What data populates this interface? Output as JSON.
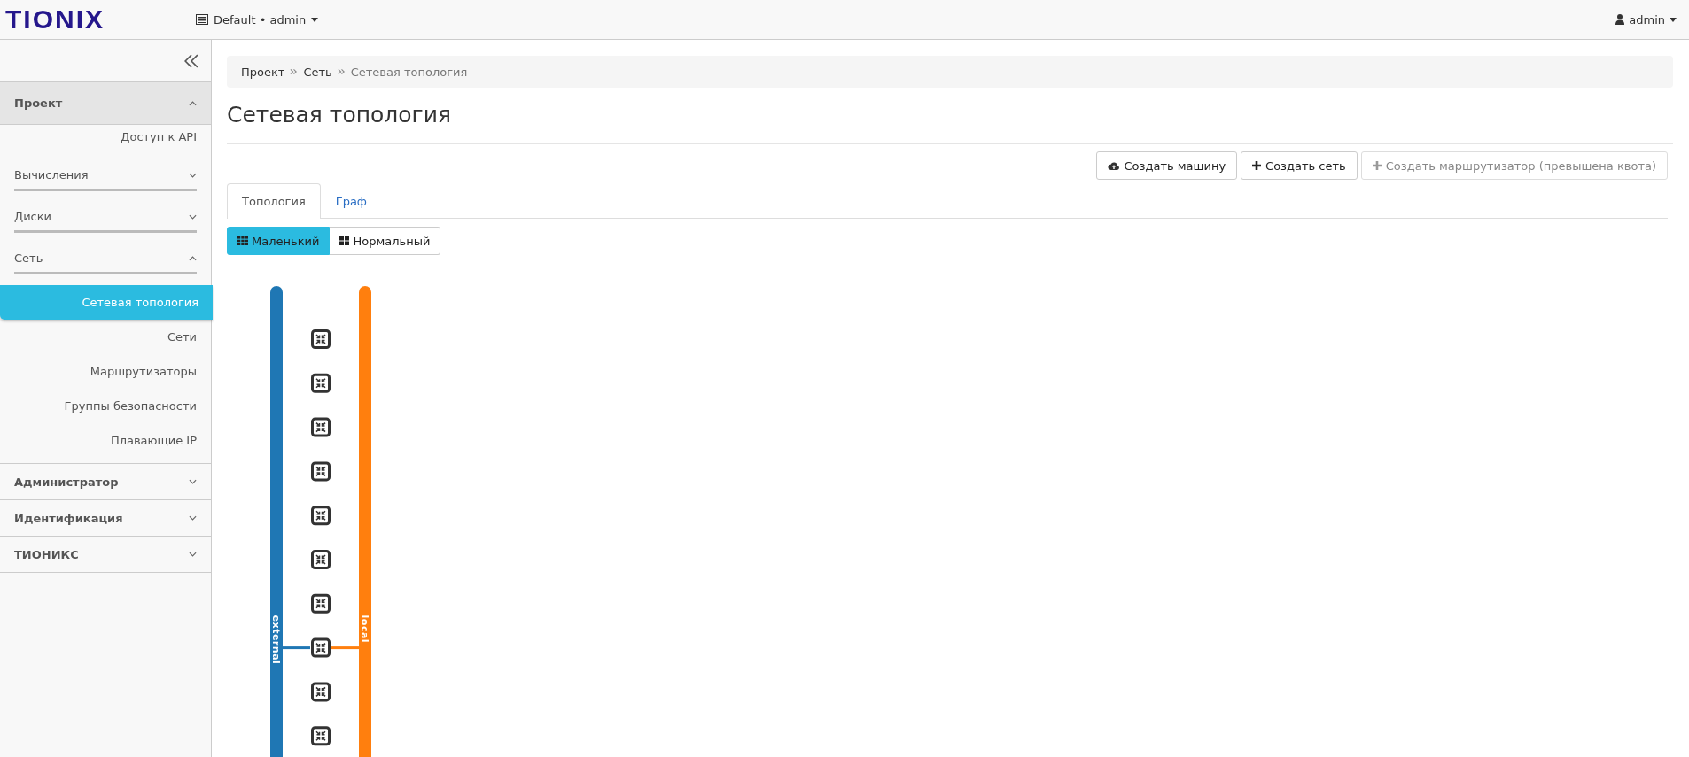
{
  "header": {
    "logo": "TIONIX",
    "project_menu": "Default • admin",
    "user_menu": "admin"
  },
  "sidebar": {
    "sections": [
      {
        "label": "Проект",
        "expanded": true,
        "children": [
          {
            "kind": "link",
            "label": "Доступ к API",
            "selected": false
          },
          {
            "kind": "group",
            "label": "Вычисления",
            "expanded": false
          },
          {
            "kind": "group",
            "label": "Диски",
            "expanded": false
          },
          {
            "kind": "group",
            "label": "Сеть",
            "expanded": true,
            "children": [
              {
                "label": "Сетевая топология",
                "selected": true
              },
              {
                "label": "Сети",
                "selected": false
              },
              {
                "label": "Маршрутизаторы",
                "selected": false
              },
              {
                "label": "Группы безопасности",
                "selected": false
              },
              {
                "label": "Плавающие IP",
                "selected": false
              }
            ]
          }
        ]
      },
      {
        "label": "Администратор",
        "expanded": false
      },
      {
        "label": "Идентификация",
        "expanded": false
      },
      {
        "label": "ТИОНИКС",
        "expanded": false
      }
    ]
  },
  "breadcrumb": [
    "Проект",
    "Сеть",
    "Сетевая топология"
  ],
  "page_title": "Сетевая топология",
  "actions": [
    {
      "kind": "instance",
      "label": "Создать машину",
      "disabled": false
    },
    {
      "kind": "add",
      "label": "Создать сеть",
      "disabled": false
    },
    {
      "kind": "add",
      "label": "Создать маршрутизатор (превышена квота)",
      "disabled": true
    }
  ],
  "tabs": [
    {
      "label": "Топология",
      "selected": true
    },
    {
      "label": "Граф",
      "selected": false
    }
  ],
  "size_toggle": [
    {
      "kind": "small",
      "label": "Маленький",
      "selected": true
    },
    {
      "kind": "normal",
      "label": "Нормальный",
      "selected": false
    }
  ],
  "topology": {
    "networks": [
      {
        "name": "external",
        "color": "#1f77b4"
      },
      {
        "name": "local",
        "color": "#ff7f0e"
      }
    ],
    "routers": [
      {
        "connected": false
      },
      {
        "connected": false
      },
      {
        "connected": false
      },
      {
        "connected": false
      },
      {
        "connected": false
      },
      {
        "connected": false
      },
      {
        "connected": false
      },
      {
        "connected": true
      },
      {
        "connected": false
      },
      {
        "connected": false
      }
    ]
  }
}
